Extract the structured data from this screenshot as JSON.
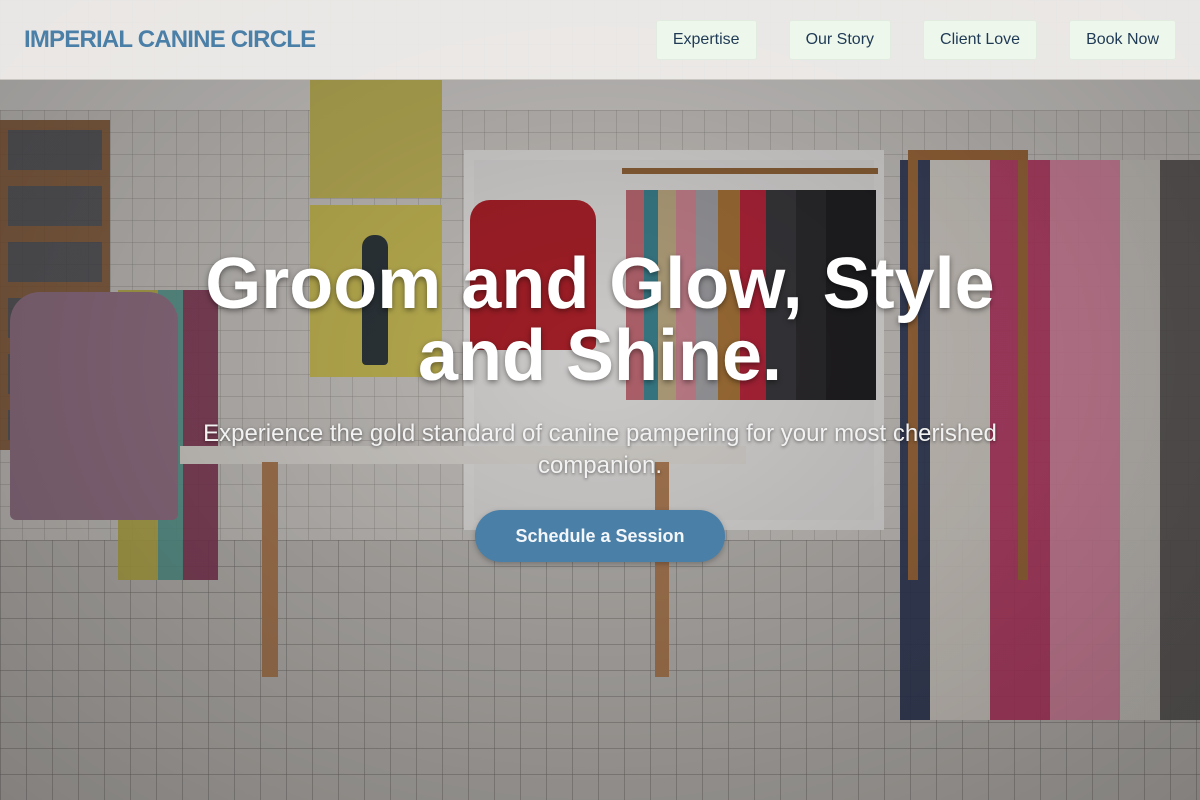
{
  "header": {
    "logo": "IMPERIAL CANINE CIRCLE",
    "nav": [
      {
        "label": "Expertise"
      },
      {
        "label": "Our Story"
      },
      {
        "label": "Client Love"
      },
      {
        "label": "Book Now"
      }
    ]
  },
  "hero": {
    "title": "Groom and Glow, Style and Shine.",
    "subtitle": "Experience the gold standard of canine pampering for your most cherished companion.",
    "cta_label": "Schedule a Session"
  },
  "colors": {
    "brand": "#4a7fa8",
    "nav_button_bg": "#eef7ec",
    "nav_text": "#1f3a55"
  }
}
